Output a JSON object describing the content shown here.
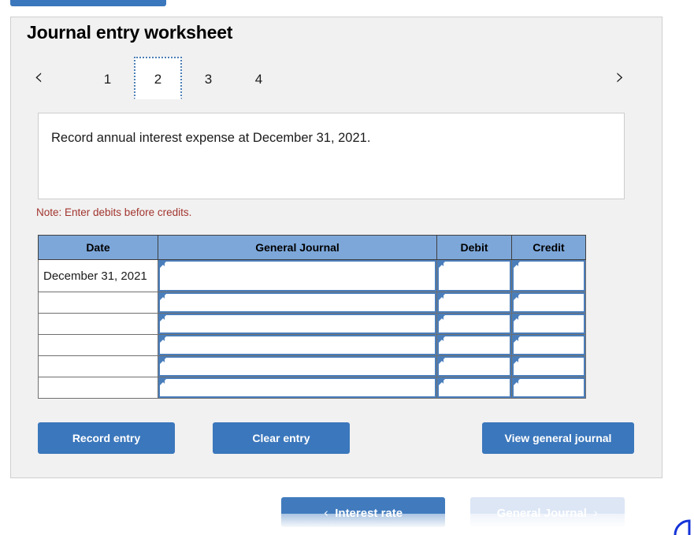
{
  "worksheet": {
    "title": "Journal entry worksheet",
    "tabs": [
      {
        "label": "1",
        "active": false
      },
      {
        "label": "2",
        "active": true
      },
      {
        "label": "3",
        "active": false
      },
      {
        "label": "4",
        "active": false
      }
    ],
    "prev_arrow": "‹",
    "next_arrow": "›",
    "description": "Record annual interest expense at December 31, 2021.",
    "note": "Note: Enter debits before credits."
  },
  "table": {
    "headers": [
      "Date",
      "General Journal",
      "Debit",
      "Credit"
    ],
    "rows": [
      {
        "date": "December 31, 2021",
        "general_journal": "",
        "debit": "",
        "credit": ""
      },
      {
        "date": "",
        "general_journal": "",
        "debit": "",
        "credit": ""
      },
      {
        "date": "",
        "general_journal": "",
        "debit": "",
        "credit": ""
      },
      {
        "date": "",
        "general_journal": "",
        "debit": "",
        "credit": ""
      },
      {
        "date": "",
        "general_journal": "",
        "debit": "",
        "credit": ""
      },
      {
        "date": "",
        "general_journal": "",
        "debit": "",
        "credit": ""
      }
    ]
  },
  "actions": {
    "record_entry": "Record entry",
    "clear_entry": "Clear entry",
    "view_general_journal": "View general journal"
  },
  "pager": {
    "prev_label": "Interest rate",
    "prev_arrow": "‹",
    "next_label": "General Journal",
    "next_arrow": "›"
  },
  "colors": {
    "accent_blue": "#3b77bc",
    "header_blue": "#7da7d9",
    "cell_border_blue": "#4a7ebb",
    "note_red": "#a2352f",
    "panel_bg": "#f1f1f1",
    "disabled_blue": "#dce6f5"
  }
}
